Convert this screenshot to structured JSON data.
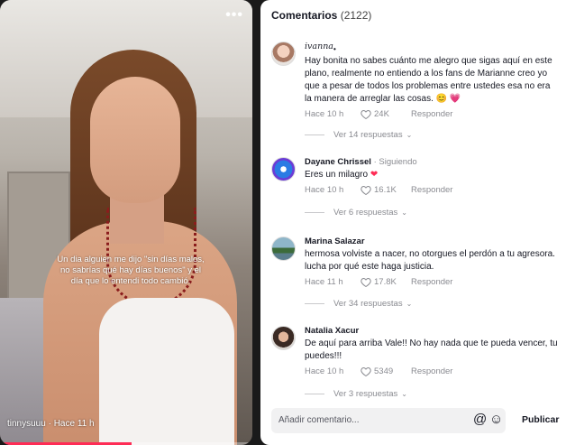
{
  "video": {
    "caption": "Un dia alguien me dijo \"sin días malos, no sabrías qué hay días buenos\" y el día que lo entendi todo cambió.",
    "author": "tinnysuuu",
    "time": "Hace 11 h",
    "author_time": "tinnysuuu · Hace 11 h",
    "progress": 0.52,
    "more_label": "•••"
  },
  "comments_panel": {
    "title": "Comentarios",
    "count": "(2122)",
    "comments": [
      {
        "username": "ivanna",
        "username_suffix": "•",
        "text": "Hay bonita no sabes cuánto me alegro que sigas aquí en este plano, realmente no entiendo a los fans de Marianne creo yo que a pesar de todos los problemas entre ustedes esa no era la manera de arreglar las cosas.",
        "emojis": "😊 💗",
        "time": "Hace 10 h",
        "likes": "24K",
        "reply": "Responder",
        "replies": "Ver 14 respuestas"
      },
      {
        "username": "Dayane Chrissel",
        "following": " · Siguiendo",
        "text": "Eres un milagro",
        "emojis": "❤",
        "time": "Hace 10 h",
        "likes": "16.1K",
        "reply": "Responder",
        "replies": "Ver 6 respuestas"
      },
      {
        "username": "Marina Salazar",
        "text": "hermosa volviste a nacer, no otorgues el perdón a tu agresora. lucha por qué este haga justicia.",
        "time": "Hace 11 h",
        "likes": "17.8K",
        "reply": "Responder",
        "replies": "Ver 34 respuestas"
      },
      {
        "username": "Natalia Xacur",
        "text": "De aquí para arriba Vale!! No hay nada que te pueda vencer, tu puedes!!!",
        "time": "Hace 10 h",
        "likes": "5349",
        "reply": "Responder",
        "replies": "Ver 3 respuestas"
      }
    ],
    "input_placeholder": "Añadir comentario...",
    "post_label": "Publicar"
  },
  "colors": {
    "accent": "#fe2c55",
    "text": "#161823",
    "muted": "#8a8b91"
  },
  "icons": [
    "more-icon",
    "heart-icon",
    "chevron-down-icon",
    "at-icon",
    "emoji-icon"
  ]
}
